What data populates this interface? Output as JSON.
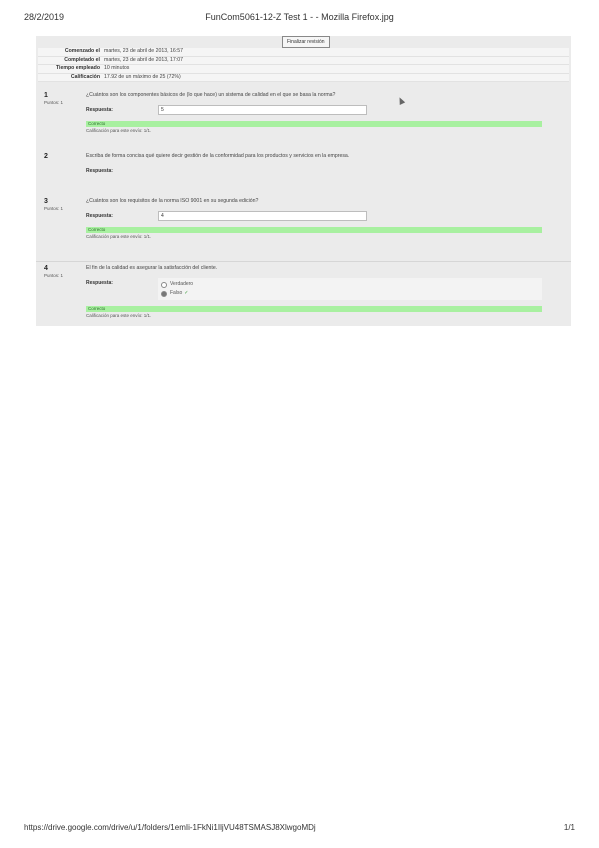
{
  "print": {
    "date": "28/2/2019",
    "title": "FunCom5061-12-Z Test 1 - - Mozilla Firefox.jpg",
    "url": "https://drive.google.com/drive/u/1/folders/1emIi-1FkNi1IljVU48TSMASJ8XlwgoMDj",
    "page": "1/1"
  },
  "toolbar": {
    "finish_label": "Finalizar revisión"
  },
  "summary": [
    {
      "label": "Comenzado el",
      "value": "martes, 23 de abril de 2013, 16:57"
    },
    {
      "label": "Completado el",
      "value": "martes, 23 de abril de 2013, 17:07"
    },
    {
      "label": "Tiempo empleado",
      "value": "10 minutos"
    },
    {
      "label": "Calificación",
      "value": "17.92 de un máximo de 25 (72%)"
    }
  ],
  "questions": [
    {
      "num": "1",
      "mark": "Puntos: 1",
      "text": "¿Cuántos son los componentes básicos de (lo que hace) un sistema de calidad en el que se basa la norma?",
      "response_label": "Respuesta:",
      "response_value": "5",
      "result": "Correcto",
      "mark_text": "Calificación para este envío: 1/1."
    },
    {
      "num": "2",
      "text": "Escriba de forma concisa qué quiere decir gestión de la conformidad para los productos y servicios en la empresa.",
      "response_label": "Respuesta:"
    },
    {
      "num": "3",
      "mark": "Puntos: 1",
      "text": "¿Cuántos son los requisitos de la norma ISO 9001 en su segunda edición?",
      "response_label": "Respuesta:",
      "response_value": "4",
      "result": "Correcto",
      "mark_text": "Calificación para este envío: 1/1."
    },
    {
      "num": "4",
      "mark": "Puntos: 1",
      "text": "El fin de la calidad es asegurar la satisfacción del cliente.",
      "response_label": "Respuesta:",
      "options": [
        {
          "label": "Verdadero",
          "checked": false
        },
        {
          "label": "Falso",
          "checked": true
        }
      ],
      "result": "Correcto",
      "mark_text": "Calificación para este envío: 1/1."
    }
  ]
}
